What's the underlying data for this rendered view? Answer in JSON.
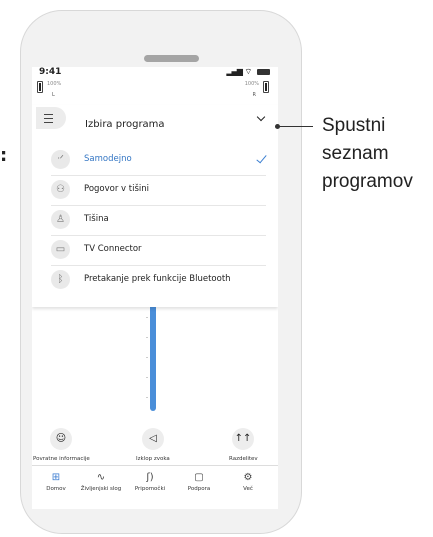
{
  "status_bar": {
    "time": "9:41"
  },
  "hearing_aids": {
    "left": {
      "battery": "100%",
      "side": "L"
    },
    "right": {
      "battery": "100%",
      "side": "R"
    }
  },
  "dropdown": {
    "title": "Izbira programa",
    "items": [
      {
        "label": "Samodejno",
        "icon": "auto-program-icon",
        "selected": true
      },
      {
        "label": "Pogovor v tišini",
        "icon": "conversation-icon",
        "selected": false
      },
      {
        "label": "Tišina",
        "icon": "quiet-icon",
        "selected": false
      },
      {
        "label": "TV Connector",
        "icon": "tv-icon",
        "selected": false
      },
      {
        "label": "Pretakanje prek funkcije Bluetooth",
        "icon": "bluetooth-icon",
        "selected": false
      }
    ],
    "selected_color": "#3476c4"
  },
  "volume": {
    "accent": "#4a8ed9"
  },
  "quick_actions": [
    {
      "label": "Povratne informacije",
      "icon": "smiley-icon"
    },
    {
      "label": "Izklop zvoka",
      "icon": "speaker-mute-icon"
    },
    {
      "label": "Razdelitev",
      "icon": "split-icon"
    }
  ],
  "tabs": [
    {
      "label": "Domov",
      "icon": "home-grid-icon",
      "active": true
    },
    {
      "label": "Življenjski slog",
      "icon": "activity-icon",
      "active": false
    },
    {
      "label": "Pripomočki",
      "icon": "hearing-aid-icon",
      "active": false
    },
    {
      "label": "Podpora",
      "icon": "chat-icon",
      "active": false
    },
    {
      "label": "Več",
      "icon": "gear-icon",
      "active": false
    }
  ],
  "annotation": {
    "line1": "Spustni",
    "line2": "seznam",
    "line3": "programov"
  },
  "margin_mark": ":"
}
